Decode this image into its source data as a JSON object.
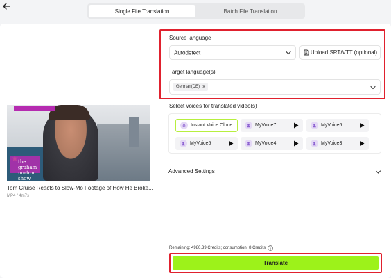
{
  "tabs": [
    {
      "label": "Single File Translation",
      "active": true
    },
    {
      "label": "Batch File Translation",
      "active": false
    }
  ],
  "video": {
    "title": "Tom Cruise Reacts to Slow-Mo Footage of How He Broke...",
    "meta": "MP4 / 4m7s",
    "logo_text": "the graham norton show"
  },
  "source": {
    "label": "Source language",
    "selected": "Autodetect",
    "upload_label": "Upload SRT/VTT (optional)"
  },
  "target": {
    "label": "Target language(s)",
    "chips": [
      "German(DE)"
    ]
  },
  "voices": {
    "label": "Select voices for translated video(s)",
    "items": [
      {
        "name": "Instant Voice Clone",
        "playable": false,
        "selected": true
      },
      {
        "name": "MyVoice7",
        "playable": true
      },
      {
        "name": "MyVoice6",
        "playable": true
      },
      {
        "name": "MyVoice5",
        "playable": true
      },
      {
        "name": "MyVoice4",
        "playable": true
      },
      {
        "name": "MyVoice3",
        "playable": true
      }
    ]
  },
  "advanced": {
    "label": "Advanced Settings"
  },
  "credits": {
    "text": "Remaining: 4980.39 Credits; consumption: 8 Credits"
  },
  "translate": {
    "label": "Translate"
  },
  "colors": {
    "accent": "#9df21a",
    "highlight_border": "#e0212e",
    "voice_avatar": "#e4d8f5"
  }
}
